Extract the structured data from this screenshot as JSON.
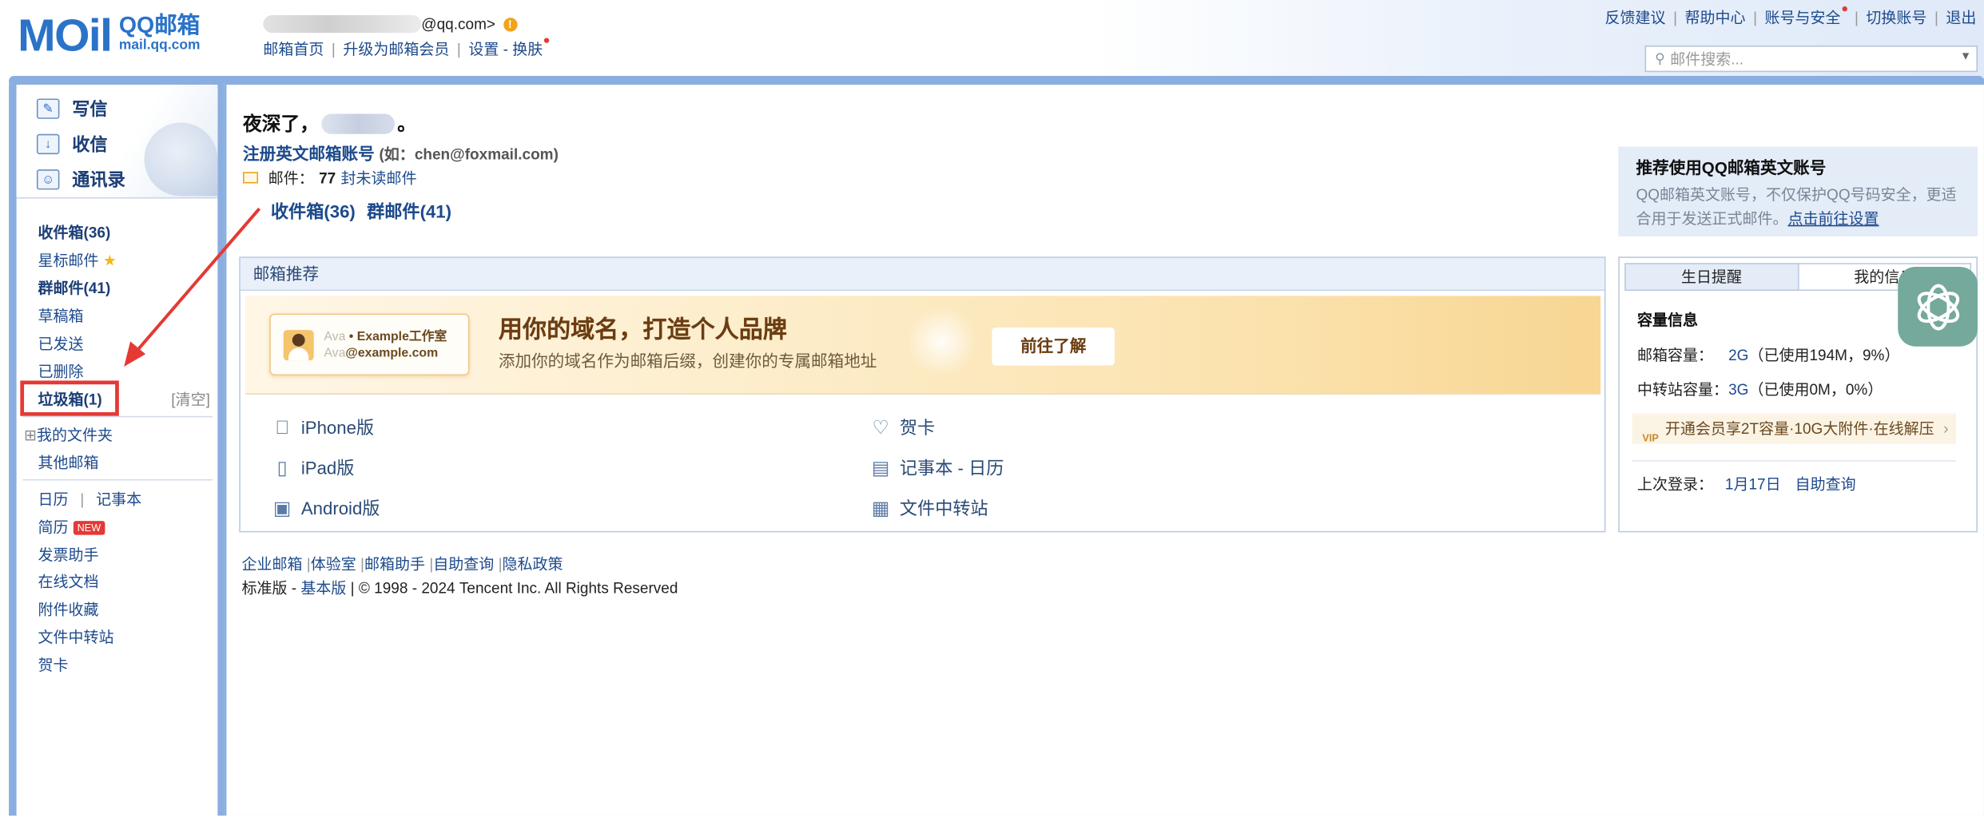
{
  "header": {
    "logo_mail": "MOil",
    "logo_title": "QQ邮箱",
    "logo_domain": "mail.qq.com",
    "email_suffix": "@qq.com>",
    "nav": [
      "邮箱首页",
      "升级为邮箱会员",
      "设置 - 换肤"
    ],
    "top_links": [
      "反馈建议",
      "帮助中心",
      "账号与安全",
      "切换账号",
      "退出"
    ],
    "search_placeholder": "邮件搜索..."
  },
  "sidebar": {
    "actions": [
      "写信",
      "收信",
      "通讯录"
    ],
    "folders": {
      "inbox": "收件箱(36)",
      "starred": "星标邮件",
      "group": "群邮件(41)",
      "drafts": "草稿箱",
      "sent": "已发送",
      "deleted": "已删除",
      "junk": "垃圾箱(1)",
      "clear": "[清空]",
      "my_folders": "我的文件夹",
      "other_mailbox": "其他邮箱"
    },
    "tools": {
      "calendar": "日历",
      "notes": "记事本",
      "resume": "简历",
      "resume_badge": "NEW",
      "invoice": "发票助手",
      "docs": "在线文档",
      "attachments": "附件收藏",
      "transfer": "文件中转站",
      "cards": "贺卡"
    }
  },
  "main": {
    "greeting_prefix": "夜深了，",
    "greeting_suffix": "。",
    "register_link": "注册英文邮箱账号",
    "register_hint": "(如：chen@foxmail.com)",
    "mail_label": "邮件：",
    "unread_count": "77",
    "unread_text": "封未读邮件",
    "inbox_link": "收件箱(36)",
    "group_link": "群邮件(41)",
    "recommend": {
      "title": "邮箱推荐",
      "card_line1_gray": "Ava",
      "card_line1_dark": "• Example工作室",
      "card_line2_gray": "Ava",
      "card_line2_dark": "@example.com",
      "banner_title": "用你的域名，打造个人品牌",
      "banner_sub": "添加你的域名作为邮箱后缀，创建你的专属邮箱地址",
      "banner_button": "前往了解",
      "clients": [
        "iPhone版",
        "iPad版",
        "Android版"
      ],
      "features": [
        "贺卡",
        "记事本 - 日历",
        "文件中转站"
      ]
    },
    "footer_links": [
      "企业邮箱",
      "体验室",
      "邮箱助手",
      "自助查询",
      "隐私政策"
    ],
    "footer_std": "标准版 - ",
    "footer_basic": "基本版",
    "footer_copy": " | © 1998 - 2024 Tencent Inc. All Rights Reserved"
  },
  "right": {
    "promo_title": "推荐使用QQ邮箱英文账号",
    "promo_desc": "QQ邮箱英文账号，不仅保护QQ号码安全，更适合用于发送正式邮件。",
    "promo_link": "点击前往设置",
    "tabs": [
      "生日提醒",
      "我的信息"
    ],
    "capacity_title": "容量信息",
    "mailbox_cap_label": "邮箱容量：",
    "mailbox_cap_value": "2G",
    "mailbox_cap_detail": "（已使用194M，9%）",
    "transfer_cap_label": "中转站容量：",
    "transfer_cap_value": "3G",
    "transfer_cap_detail": "（已使用0M，0%）",
    "vip_badge": "VIP",
    "vip_text": "开通会员享2T容量·10G大附件·在线解压",
    "last_login_label": "上次登录：",
    "last_login_date": "1月17日",
    "self_query": "自助查询"
  },
  "colors": {
    "frame": "#8aaee0",
    "link": "#1d4a8c",
    "highlight_box": "#e53935"
  },
  "icons": [
    "warning-icon",
    "search-icon",
    "compose-icon",
    "inbox-icon",
    "contacts-icon",
    "star-icon",
    "apple-icon",
    "tablet-icon",
    "android-icon",
    "heart-icon",
    "calendar-icon",
    "transfer-icon",
    "chatgpt-icon"
  ]
}
